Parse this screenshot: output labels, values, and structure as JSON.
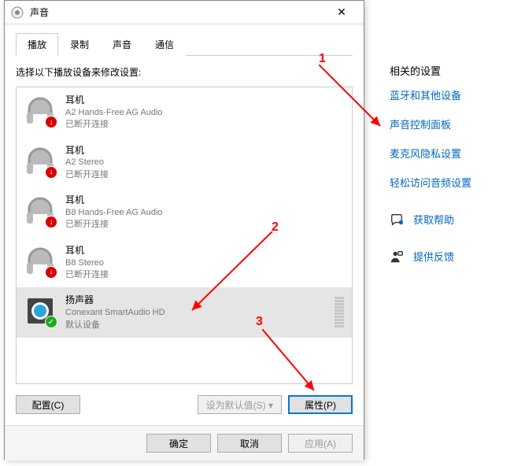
{
  "dialog": {
    "title": "声音",
    "tabs": [
      "播放",
      "录制",
      "声音",
      "通信"
    ],
    "activeTab": 0,
    "prompt": "选择以下播放设备来修改设置:",
    "devices": [
      {
        "name": "耳机",
        "desc": "A2 Hands-Free AG Audio",
        "status": "已断开连接",
        "selected": false,
        "badge": "red",
        "kind": "headphone"
      },
      {
        "name": "耳机",
        "desc": "A2 Stereo",
        "status": "已断开连接",
        "selected": false,
        "badge": "red",
        "kind": "headphone"
      },
      {
        "name": "耳机",
        "desc": "B8 Hands-Free AG Audio",
        "status": "已断开连接",
        "selected": false,
        "badge": "red",
        "kind": "headphone"
      },
      {
        "name": "耳机",
        "desc": "B8 Stereo",
        "status": "已断开连接",
        "selected": false,
        "badge": "red",
        "kind": "headphone"
      },
      {
        "name": "扬声器",
        "desc": "Conexant SmartAudio HD",
        "status": "默认设备",
        "selected": true,
        "badge": "green",
        "kind": "speaker"
      }
    ],
    "configureBtn": "配置(C)",
    "setDefaultBtn": "设为默认值(S)",
    "propertiesBtn": "属性(P)",
    "okBtn": "确定",
    "cancelBtn": "取消",
    "applyBtn": "应用(A)"
  },
  "side": {
    "heading": "相关的设置",
    "links": [
      "蓝牙和其他设备",
      "声音控制面板",
      "麦克风隐私设置",
      "轻松访问音频设置"
    ],
    "actions": [
      {
        "icon": "help",
        "label": "获取帮助"
      },
      {
        "icon": "feedback",
        "label": "提供反馈"
      }
    ]
  },
  "annotations": {
    "n1": "1",
    "n2": "2",
    "n3": "3"
  }
}
